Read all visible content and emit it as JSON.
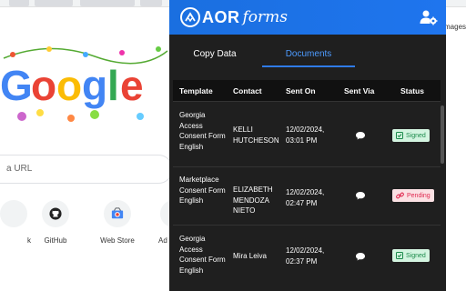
{
  "browser": {
    "right_text": "mages",
    "search_placeholder": "a URL",
    "shortcuts": [
      {
        "label": "k",
        "icon": "shortcut-icon"
      },
      {
        "label": "GitHub",
        "icon": "github-icon"
      },
      {
        "label": "Web Store",
        "icon": "chrome-web-store-icon"
      },
      {
        "label": "Ad",
        "icon": "shortcut-icon"
      }
    ]
  },
  "extension": {
    "logo_bold": "AOR",
    "logo_italic": "forms",
    "tabs": [
      {
        "label": "Copy Data",
        "active": false
      },
      {
        "label": "Documents",
        "active": true
      }
    ],
    "table": {
      "headers": [
        "Template",
        "Contact",
        "Sent On",
        "Sent Via",
        "Status"
      ],
      "rows": [
        {
          "template": "Georgia Access Consent Form English",
          "contact": "KELLI HUTCHESON",
          "sent_on": "12/02/2024, 03:01 PM",
          "via_icon": "chat-icon",
          "status": "Signed"
        },
        {
          "template": "Marketplace Consent Form English",
          "contact": "ELIZABETH MENDOZA NIETO",
          "sent_on": "12/02/2024, 02:47 PM",
          "via_icon": "chat-icon",
          "status": "Pending"
        },
        {
          "template": "Georgia Access Consent Form English",
          "contact": "Mira Leiva",
          "sent_on": "12/02/2024, 02:37 PM",
          "via_icon": "chat-icon",
          "status": "Signed"
        }
      ]
    }
  },
  "colors": {
    "header_blue": "#1a6fe0",
    "panel_bg": "#1f1f1f",
    "signed_bg": "#d3f4e0",
    "signed_fg": "#1a8a4a",
    "pending_bg": "#fbe1e4",
    "pending_fg": "#e02950"
  }
}
